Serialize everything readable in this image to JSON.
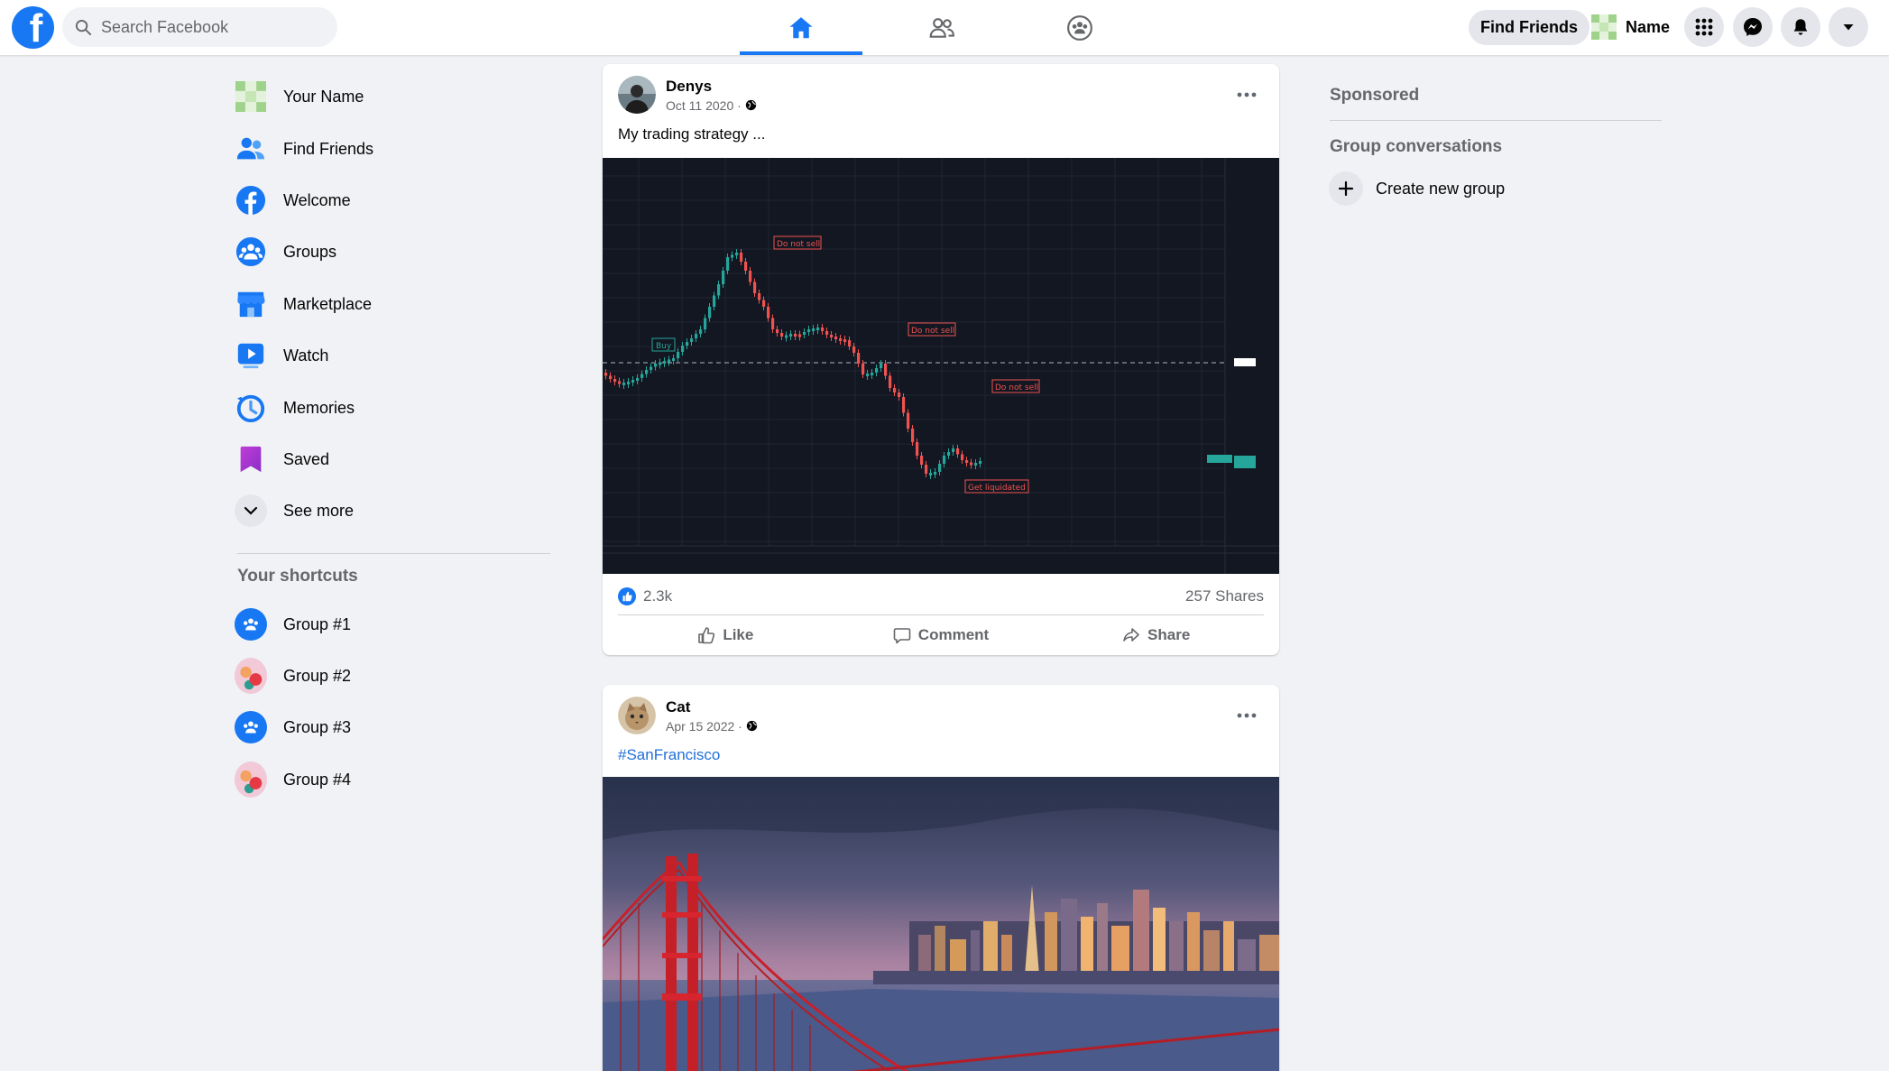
{
  "header": {
    "logo_letter": "f",
    "search_placeholder": "Search Facebook",
    "nav_tabs": [
      {
        "name": "home",
        "active": true
      },
      {
        "name": "friends",
        "active": false
      },
      {
        "name": "groups",
        "active": false
      }
    ],
    "find_friends_label": "Find Friends",
    "profile_name": "Name",
    "icons": [
      "menu-grid-icon",
      "messenger-icon",
      "notifications-bell-icon",
      "account-caret-icon"
    ]
  },
  "sidebar": {
    "items": [
      {
        "label": "Your Name",
        "icon": "profile-avatar-icon"
      },
      {
        "label": "Find Friends",
        "icon": "friends-icon"
      },
      {
        "label": "Welcome",
        "icon": "facebook-icon"
      },
      {
        "label": "Groups",
        "icon": "groups-icon"
      },
      {
        "label": "Marketplace",
        "icon": "marketplace-icon"
      },
      {
        "label": "Watch",
        "icon": "watch-icon"
      },
      {
        "label": "Memories",
        "icon": "memories-icon"
      },
      {
        "label": "Saved",
        "icon": "saved-icon"
      },
      {
        "label": "See more",
        "icon": "chevron-down-icon"
      }
    ],
    "shortcuts_heading": "Your shortcuts",
    "shortcuts": [
      {
        "label": "Group #1"
      },
      {
        "label": "Group #2"
      },
      {
        "label": "Group #3"
      },
      {
        "label": "Group #4"
      }
    ]
  },
  "feed": {
    "posts": [
      {
        "author": "Denys",
        "date": "Oct 11 2020",
        "text": "My trading strategy ...",
        "likes": "2.3k",
        "shares": "257 Shares",
        "chart_annotations": {
          "buy": "Buy",
          "dont_sell_1": "Do not sell",
          "dont_sell_2": "Do not sell",
          "dont_sell_3": "Do not sell",
          "liquidated": "Get liquidated"
        }
      },
      {
        "author": "Cat",
        "date": "Apr 15 2022",
        "hashtag": "#SanFrancisco"
      }
    ],
    "actions": {
      "like": "Like",
      "comment": "Comment",
      "share": "Share"
    }
  },
  "right_sidebar": {
    "sponsored_heading": "Sponsored",
    "group_conversations_heading": "Group conversations",
    "create_group_label": "Create new group"
  },
  "colors": {
    "brand": "#1877f2",
    "background": "#f0f2f5",
    "candle_up": "#26a69a",
    "candle_down": "#ef5350"
  }
}
